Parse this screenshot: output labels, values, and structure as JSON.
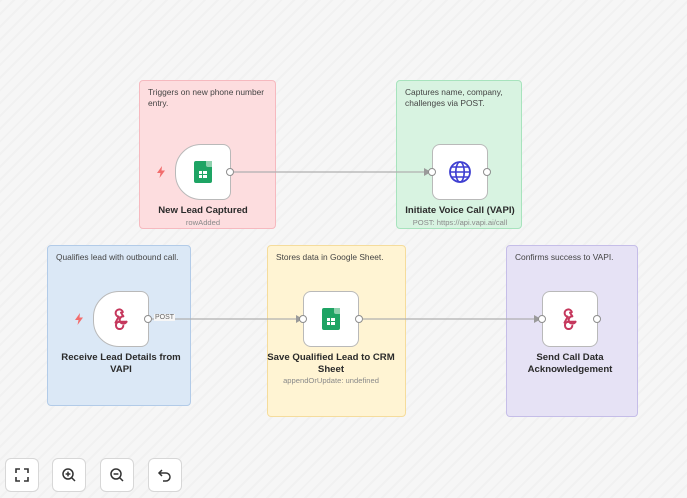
{
  "sticky_notes": [
    {
      "text": "Triggers on new phone number entry."
    },
    {
      "text": "Captures name, company, challenges via POST."
    },
    {
      "text": "Qualifies lead with outbound call."
    },
    {
      "text": "Stores data in Google Sheet."
    },
    {
      "text": "Confirms success to VAPI."
    }
  ],
  "nodes": [
    {
      "title": "New Lead Captured",
      "subtitle": "rowAdded",
      "icon": "google-sheets-icon"
    },
    {
      "title": "Initiate Voice Call (VAPI)",
      "subtitle": "POST: https://api.vapi.ai/call",
      "icon": "globe-icon"
    },
    {
      "title": "Receive Lead Details from VAPI",
      "subtitle": "",
      "icon": "webhook-icon"
    },
    {
      "title": "Save Qualified Lead to CRM Sheet",
      "subtitle": "appendOrUpdate: undefined",
      "icon": "google-sheets-icon"
    },
    {
      "title": "Send Call Data Acknowledgement",
      "subtitle": "",
      "icon": "webhook-icon"
    }
  ],
  "edges": [
    {
      "label": ""
    },
    {
      "label": "POST"
    },
    {
      "label": ""
    }
  ],
  "colors": {
    "trigger_bolt": "#f26d6d",
    "sheets_green": "#1ea464",
    "globe_blue": "#3f3fd1",
    "webhook_pink": "#c5375c"
  },
  "controls": [
    {
      "icon": "fit-view-icon"
    },
    {
      "icon": "zoom-in-icon"
    },
    {
      "icon": "zoom-out-icon"
    },
    {
      "icon": "reset-icon"
    }
  ]
}
